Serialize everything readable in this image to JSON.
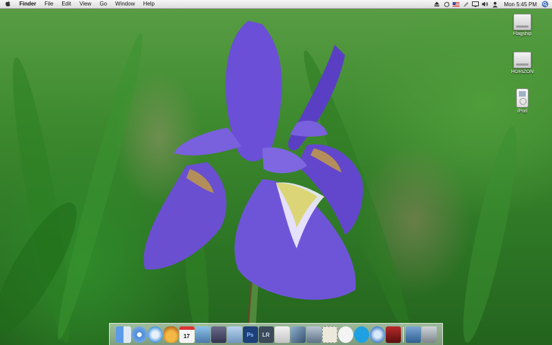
{
  "menubar": {
    "apple_icon": "apple-icon",
    "app_name": "Finder",
    "menus": [
      "File",
      "Edit",
      "View",
      "Go",
      "Window",
      "Help"
    ],
    "status_icons": [
      "eject-icon",
      "sync-icon",
      "flag-us-icon",
      "pen-icon",
      "battery-icon",
      "display-icon",
      "volume-icon",
      "user-icon"
    ],
    "clock": "Mon 5:45 PM",
    "spotlight_icon": "spotlight-search-icon"
  },
  "desktop_icons": [
    {
      "label": "Flagship",
      "icon": "hard-drive-icon"
    },
    {
      "label": "HORIZON",
      "icon": "hard-drive-icon"
    },
    {
      "label": "iPod",
      "icon": "ipod-icon"
    }
  ],
  "wallpaper": {
    "subject": "purple-iris-icon",
    "colors": {
      "petal": "#6a4fd0",
      "grass": "#3e8a2f"
    }
  },
  "dock": {
    "items": [
      {
        "icon": "finder-icon",
        "color": "#3b79d6"
      },
      {
        "icon": "itunes-icon",
        "color": "#4a8bd8"
      },
      {
        "icon": "safari-icon",
        "color": "#4a97e0"
      },
      {
        "icon": "garageband-icon",
        "color": "#e0a030"
      },
      {
        "icon": "ical-icon",
        "color": "#e8e8e8",
        "text": "17"
      },
      {
        "icon": "iphoto-icon",
        "color": "#6a9ccf"
      },
      {
        "icon": "imovie-icon",
        "color": "#5a5a7a"
      },
      {
        "icon": "preview-icon",
        "color": "#7aa1c9"
      },
      {
        "icon": "photoshop-icon",
        "color": "#1d3f7a",
        "text": "Ps"
      },
      {
        "icon": "lightroom-icon",
        "color": "#3c4a5a",
        "text": "LR"
      },
      {
        "icon": "apple-store-icon",
        "color": "#d9d9d9"
      },
      {
        "icon": "pen-tool-icon",
        "color": "#4a6a8a"
      },
      {
        "icon": "network-icon",
        "color": "#7d8fa3"
      },
      {
        "icon": "mail-stamp-icon",
        "color": "#e6e2d6"
      },
      {
        "icon": "ichat-icon",
        "color": "#f2f2f2"
      },
      {
        "icon": "skype-icon",
        "color": "#1fa0e0"
      },
      {
        "icon": "compass-icon",
        "color": "#3a78c8"
      },
      {
        "icon": "photo-booth-icon",
        "color": "#8a1a1a"
      },
      {
        "icon": "downloads-stack-icon",
        "color": "#3a6a9a"
      },
      {
        "icon": "trash-icon",
        "color": "#9aa3ab"
      }
    ]
  }
}
